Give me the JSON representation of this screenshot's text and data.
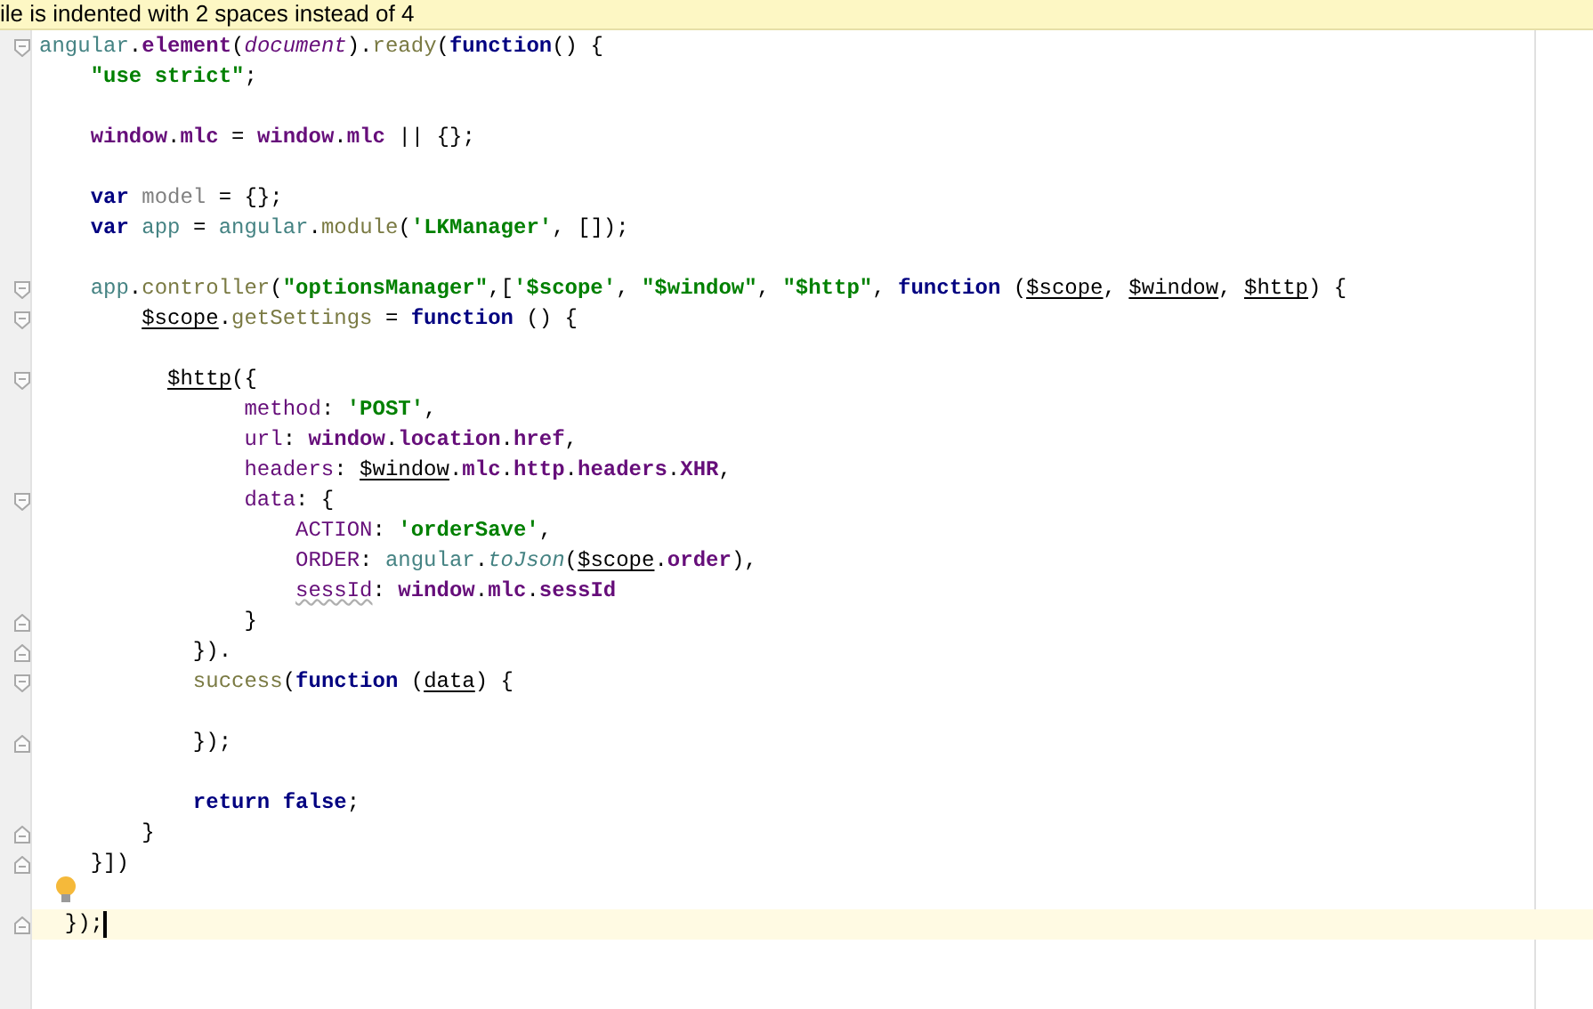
{
  "banner": {
    "text": "ile is indented with 2 spaces instead of 4"
  },
  "lines": [
    {
      "fold_start": true,
      "fold_end": false,
      "current": false,
      "tokens": [
        {
          "kind": "id",
          "t": "angular"
        },
        {
          "kind": "plain",
          "t": "."
        },
        {
          "kind": "prop",
          "t": "element"
        },
        {
          "kind": "plain",
          "t": "("
        },
        {
          "kind": "ital",
          "t": "document"
        },
        {
          "kind": "plain",
          "t": ")."
        },
        {
          "kind": "fn",
          "t": "ready"
        },
        {
          "kind": "plain",
          "t": "("
        },
        {
          "kind": "kw",
          "t": "function"
        },
        {
          "kind": "plain",
          "t": "() {"
        }
      ]
    },
    {
      "fold_start": false,
      "fold_end": false,
      "current": false,
      "tokens": [
        {
          "kind": "str",
          "t": "    \"use strict\""
        },
        {
          "kind": "plain",
          "t": ";"
        }
      ]
    },
    {
      "fold_start": false,
      "fold_end": false,
      "current": false
    },
    {
      "fold_start": false,
      "fold_end": false,
      "current": false,
      "tokens": [
        {
          "kind": "prop",
          "t": "    window"
        },
        {
          "kind": "plain",
          "t": "."
        },
        {
          "kind": "prop",
          "t": "mlc"
        },
        {
          "kind": "plain",
          "t": " = "
        },
        {
          "kind": "prop",
          "t": "window"
        },
        {
          "kind": "plain",
          "t": "."
        },
        {
          "kind": "prop",
          "t": "mlc"
        },
        {
          "kind": "plain",
          "t": " || {};"
        }
      ]
    },
    {
      "fold_start": false,
      "fold_end": false,
      "current": false
    },
    {
      "fold_start": false,
      "fold_end": false,
      "current": false,
      "tokens": [
        {
          "kind": "kw",
          "t": "    var"
        },
        {
          "kind": "unused",
          "t": " model"
        },
        {
          "kind": "plain",
          "t": " = {};"
        }
      ]
    },
    {
      "fold_start": false,
      "fold_end": false,
      "current": false,
      "tokens": [
        {
          "kind": "kw",
          "t": "    var"
        },
        {
          "kind": "id",
          "t": " app"
        },
        {
          "kind": "plain",
          "t": " = "
        },
        {
          "kind": "id",
          "t": "angular"
        },
        {
          "kind": "plain",
          "t": "."
        },
        {
          "kind": "fn",
          "t": "module"
        },
        {
          "kind": "plain",
          "t": "("
        },
        {
          "kind": "str",
          "t": "'LKManager'"
        },
        {
          "kind": "plain",
          "t": ", []);"
        }
      ]
    },
    {
      "fold_start": false,
      "fold_end": false,
      "current": false
    },
    {
      "fold_start": true,
      "fold_end": false,
      "current": false,
      "tokens": [
        {
          "kind": "id",
          "t": "    app"
        },
        {
          "kind": "plain",
          "t": "."
        },
        {
          "kind": "fn",
          "t": "controller"
        },
        {
          "kind": "plain",
          "t": "("
        },
        {
          "kind": "str",
          "t": "\"optionsManager\""
        },
        {
          "kind": "plain",
          "t": ",["
        },
        {
          "kind": "str",
          "t": "'$scope'"
        },
        {
          "kind": "plain",
          "t": ", "
        },
        {
          "kind": "str",
          "t": "\"$window\""
        },
        {
          "kind": "plain",
          "t": ", "
        },
        {
          "kind": "str",
          "t": "\"$http\""
        },
        {
          "kind": "plain",
          "t": ", "
        },
        {
          "kind": "kw",
          "t": "function"
        },
        {
          "kind": "plain",
          "t": " ("
        },
        {
          "kind": "ref",
          "t": "$scope"
        },
        {
          "kind": "plain",
          "t": ", "
        },
        {
          "kind": "ref",
          "t": "$window"
        },
        {
          "kind": "plain",
          "t": ", "
        },
        {
          "kind": "ref",
          "t": "$http"
        },
        {
          "kind": "plain",
          "t": ") {"
        }
      ]
    },
    {
      "fold_start": true,
      "fold_end": false,
      "current": false,
      "tokens": [
        {
          "kind": "ref",
          "t": "        $scope"
        },
        {
          "kind": "plain",
          "t": "."
        },
        {
          "kind": "fn",
          "t": "getSettings"
        },
        {
          "kind": "plain",
          "t": " = "
        },
        {
          "kind": "kw",
          "t": "function"
        },
        {
          "kind": "plain",
          "t": " () {"
        }
      ]
    },
    {
      "fold_start": false,
      "fold_end": false,
      "current": false
    },
    {
      "fold_start": true,
      "fold_end": false,
      "current": false,
      "tokens": [
        {
          "kind": "ref",
          "t": "          $http"
        },
        {
          "kind": "plain",
          "t": "({"
        }
      ]
    },
    {
      "fold_start": false,
      "fold_end": false,
      "current": false,
      "tokens": [
        {
          "kind": "key",
          "t": "                method"
        },
        {
          "kind": "plain",
          "t": ": "
        },
        {
          "kind": "str",
          "t": "'POST'"
        },
        {
          "kind": "plain",
          "t": ","
        }
      ]
    },
    {
      "fold_start": false,
      "fold_end": false,
      "current": false,
      "tokens": [
        {
          "kind": "key",
          "t": "                url"
        },
        {
          "kind": "plain",
          "t": ": "
        },
        {
          "kind": "prop",
          "t": "window"
        },
        {
          "kind": "plain",
          "t": "."
        },
        {
          "kind": "prop",
          "t": "location"
        },
        {
          "kind": "plain",
          "t": "."
        },
        {
          "kind": "prop",
          "t": "href"
        },
        {
          "kind": "plain",
          "t": ","
        }
      ]
    },
    {
      "fold_start": false,
      "fold_end": false,
      "current": false,
      "tokens": [
        {
          "kind": "key",
          "t": "                headers"
        },
        {
          "kind": "plain",
          "t": ": "
        },
        {
          "kind": "ref",
          "t": "$window"
        },
        {
          "kind": "plain",
          "t": "."
        },
        {
          "kind": "prop",
          "t": "mlc"
        },
        {
          "kind": "plain",
          "t": "."
        },
        {
          "kind": "prop",
          "t": "http"
        },
        {
          "kind": "plain",
          "t": "."
        },
        {
          "kind": "prop",
          "t": "headers"
        },
        {
          "kind": "plain",
          "t": "."
        },
        {
          "kind": "prop",
          "t": "XHR"
        },
        {
          "kind": "plain",
          "t": ","
        }
      ]
    },
    {
      "fold_start": true,
      "fold_end": false,
      "current": false,
      "tokens": [
        {
          "kind": "key",
          "t": "                data"
        },
        {
          "kind": "plain",
          "t": ": {"
        }
      ]
    },
    {
      "fold_start": false,
      "fold_end": false,
      "current": false,
      "tokens": [
        {
          "kind": "key",
          "t": "                    ACTION"
        },
        {
          "kind": "plain",
          "t": ": "
        },
        {
          "kind": "str",
          "t": "'orderSave'"
        },
        {
          "kind": "plain",
          "t": ","
        }
      ]
    },
    {
      "fold_start": false,
      "fold_end": false,
      "current": false,
      "tokens": [
        {
          "kind": "key",
          "t": "                    ORDER"
        },
        {
          "kind": "plain",
          "t": ": "
        },
        {
          "kind": "id",
          "t": "angular"
        },
        {
          "kind": "plain",
          "t": "."
        },
        {
          "kind": "itfn",
          "t": "toJson"
        },
        {
          "kind": "plain",
          "t": "("
        },
        {
          "kind": "ref",
          "t": "$scope"
        },
        {
          "kind": "plain",
          "t": "."
        },
        {
          "kind": "prop",
          "t": "order"
        },
        {
          "kind": "plain",
          "t": "),"
        }
      ]
    },
    {
      "fold_start": false,
      "fold_end": false,
      "current": false,
      "tokens": [
        {
          "kind": "typo",
          "t": "                    sessId"
        },
        {
          "kind": "plain",
          "t": ": "
        },
        {
          "kind": "prop",
          "t": "window"
        },
        {
          "kind": "plain",
          "t": "."
        },
        {
          "kind": "prop",
          "t": "mlc"
        },
        {
          "kind": "plain",
          "t": "."
        },
        {
          "kind": "prop",
          "t": "sessId"
        }
      ]
    },
    {
      "fold_start": false,
      "fold_end": true,
      "current": false,
      "tokens": [
        {
          "kind": "plain",
          "t": "                }"
        }
      ]
    },
    {
      "fold_start": false,
      "fold_end": true,
      "current": false,
      "tokens": [
        {
          "kind": "plain",
          "t": "            })."
        }
      ]
    },
    {
      "fold_start": true,
      "fold_end": false,
      "current": false,
      "tokens": [
        {
          "kind": "fn",
          "t": "            success"
        },
        {
          "kind": "plain",
          "t": "("
        },
        {
          "kind": "kw",
          "t": "function"
        },
        {
          "kind": "plain",
          "t": " ("
        },
        {
          "kind": "ref",
          "t": "data"
        },
        {
          "kind": "plain",
          "t": ") {"
        }
      ]
    },
    {
      "fold_start": false,
      "fold_end": false,
      "current": false
    },
    {
      "fold_start": false,
      "fold_end": true,
      "current": false,
      "tokens": [
        {
          "kind": "plain",
          "t": "            });"
        }
      ]
    },
    {
      "fold_start": false,
      "fold_end": false,
      "current": false
    },
    {
      "fold_start": false,
      "fold_end": false,
      "current": false,
      "tokens": [
        {
          "kind": "kw",
          "t": "            return"
        },
        {
          "kind": "kw",
          "t": " false"
        },
        {
          "kind": "plain",
          "t": ";"
        }
      ]
    },
    {
      "fold_start": false,
      "fold_end": true,
      "current": false,
      "tokens": [
        {
          "kind": "plain",
          "t": "        }"
        }
      ]
    },
    {
      "fold_start": false,
      "fold_end": true,
      "current": false,
      "tokens": [
        {
          "kind": "plain",
          "t": "    }])"
        }
      ]
    },
    {
      "fold_start": false,
      "fold_end": false,
      "current": false,
      "bulb": true
    },
    {
      "fold_start": false,
      "fold_end": true,
      "current": true,
      "tokens": [
        {
          "kind": "plain",
          "t": "  });"
        }
      ]
    }
  ]
}
